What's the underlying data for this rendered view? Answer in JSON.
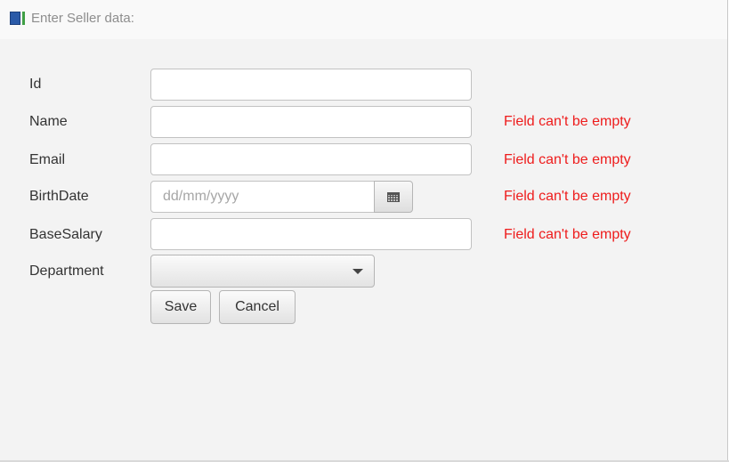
{
  "window": {
    "title": "Enter Seller data:",
    "icon": "app-window-icon"
  },
  "form": {
    "fields": [
      {
        "label": "Id",
        "value": "",
        "error": ""
      },
      {
        "label": "Name",
        "value": "",
        "error": "Field can't be empty"
      },
      {
        "label": "Email",
        "value": "",
        "error": "Field can't be empty"
      },
      {
        "label": "BirthDate",
        "value": "",
        "placeholder": "dd/mm/yyyy",
        "error": "Field can't be empty"
      },
      {
        "label": "BaseSalary",
        "value": "",
        "error": "Field can't be empty"
      },
      {
        "label": "Department",
        "value": "",
        "error": ""
      }
    ],
    "date_picker_icon": "calendar-icon",
    "dropdown_icon": "chevron-down-icon",
    "save_label": "Save",
    "cancel_label": "Cancel"
  },
  "colors": {
    "error": "#ee1c1c",
    "background": "#f3f3f3",
    "label": "#333333"
  }
}
